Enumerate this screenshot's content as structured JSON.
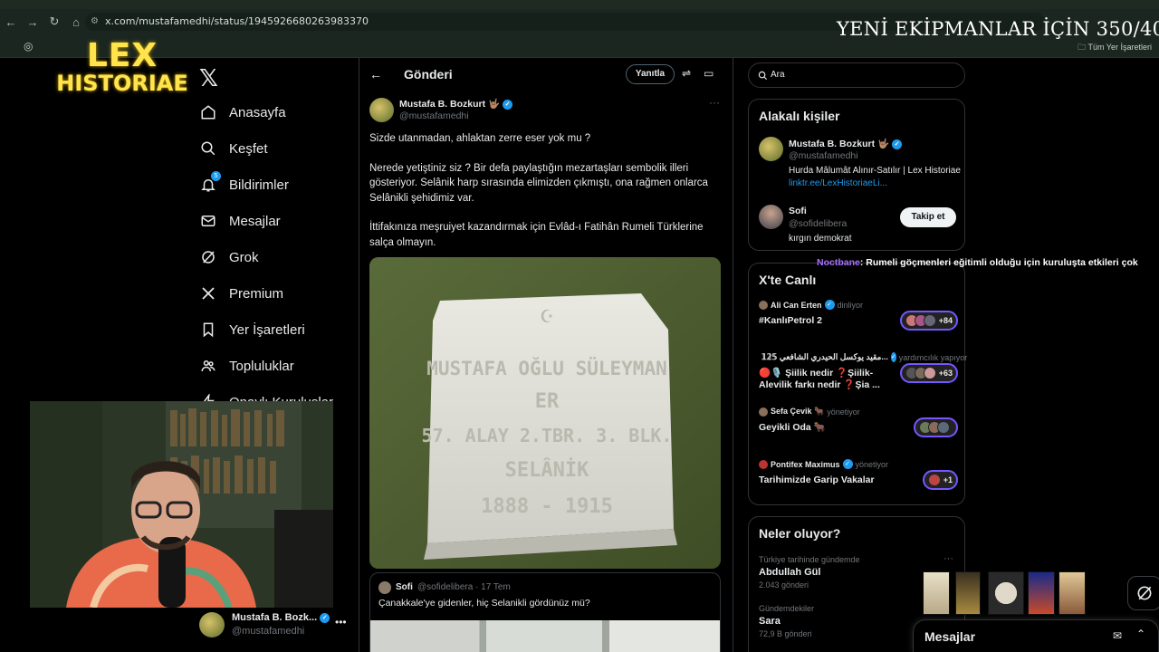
{
  "browser": {
    "url": "x.com/mustafamedhi/status/1945926680263983370",
    "bookmarks_all": "Tüm Yer İşaretleri"
  },
  "stream_overlay": {
    "title": "YENİ EKİPMANLAR İÇİN 350/400",
    "logo_line1": "LEX",
    "logo_line2": "HISTORIAE",
    "chat_user": "Noctbane",
    "chat_message": ": Rumeli göçmenleri eğitimli olduğu için kuruluşta etkileri çok"
  },
  "sidebar": {
    "items": [
      {
        "label": "Anasayfa",
        "icon": "home-icon"
      },
      {
        "label": "Keşfet",
        "icon": "search-icon"
      },
      {
        "label": "Bildirimler",
        "icon": "bell-icon",
        "badge": "5"
      },
      {
        "label": "Mesajlar",
        "icon": "mail-icon"
      },
      {
        "label": "Grok",
        "icon": "grok-icon"
      },
      {
        "label": "Premium",
        "icon": "x-icon"
      },
      {
        "label": "Yer İşaretleri",
        "icon": "bookmark-icon"
      },
      {
        "label": "Topluluklar",
        "icon": "people-icon"
      },
      {
        "label": "Onaylı Kuruluşlar",
        "icon": "lightning-icon"
      }
    ],
    "account": {
      "name": "Mustafa B. Bozk...",
      "handle": "@mustafamedhi"
    }
  },
  "header": {
    "title": "Gönderi",
    "reply_button": "Yanıtla"
  },
  "post": {
    "author": "Mustafa B. Bozkurt 🤟🏽",
    "handle": "@mustafamedhi",
    "paragraphs": [
      "Sizde utanmadan, ahlaktan zerre eser yok mu ?",
      "Nerede yetiştiniz siz ? Bir defa paylaştığın mezartaşları sembolik illeri gösteriyor. Selânik harp sırasında elimizden çıkmıştı, ona rağmen onlarca Selânikli şehidimiz var.",
      "İttifakınıza meşruiyet kazandırmak için Evlâd-ı Fatihân Rumeli Türklerine salça olmayın."
    ],
    "gravestone": {
      "line1": "MUSTAFA OĞLU SÜLEYMAN",
      "line2": "ER",
      "line3": "57. ALAY 2.TBR. 3. BLK.",
      "line4": "SELÂNİK",
      "line5": "1888 - 1915"
    }
  },
  "quote": {
    "name": "Sofi",
    "meta": "@sofidelibera · 17 Tem",
    "text": "Çanakkale'ye gidenler, hiç Selanikli gördünüz mü?"
  },
  "search": {
    "placeholder": "Ara"
  },
  "related": {
    "title": "Alakalı kişiler",
    "people": [
      {
        "name": "Mustafa B. Bozkurt 🤟🏽",
        "handle": "@mustafamedhi",
        "bio": "Hurda Mâlumât Alınır-Satılır | Lex Historiae ",
        "link": "linktr.ee/LexHistoriaeLi..."
      },
      {
        "name": "Sofi",
        "handle": "@sofidelibera",
        "bio": "kırgın demokrat",
        "follow_label": "Takip et"
      }
    ]
  },
  "live": {
    "title": "X'te Canlı",
    "items": [
      {
        "host": "Ali Can Erten",
        "status": "dinliyor",
        "title": "#KanlıPetrol 2",
        "count": "+84"
      },
      {
        "host": "مقيد يوكسل الحيدري الشافعي 𝟙𝟚𝟝...",
        "status": "yardımcılık yapıyor",
        "title": "🔴🎙️ Şiilik nedir ❓Şiilik-Alevilik farkı nedir ❓Şia ...",
        "count": "+63"
      },
      {
        "host": "Sefa Çevik 🐂",
        "status": "yönetiyor",
        "title": "Geyikli Oda 🐂",
        "count": ""
      },
      {
        "host": "Pontifex Maximus",
        "status": "yönetiyor",
        "title": "Tarihimizde Garip Vakalar",
        "count": "+1"
      }
    ]
  },
  "trends": {
    "title": "Neler oluyor?",
    "items": [
      {
        "context": "Türkiye tarihinde gündemde",
        "name": "Abdullah Gül",
        "count": "2.043 gönderi"
      },
      {
        "context": "Gündemdekiler",
        "name": "Sara",
        "count": "72,9 B gönderi"
      }
    ]
  },
  "messages_drawer": {
    "title": "Mesajlar"
  },
  "colors": {
    "accent": "#1d9bf0",
    "logo_yellow": "#ffe44d",
    "live_ring": "#7856ff",
    "chat_user": "#a970ff"
  }
}
